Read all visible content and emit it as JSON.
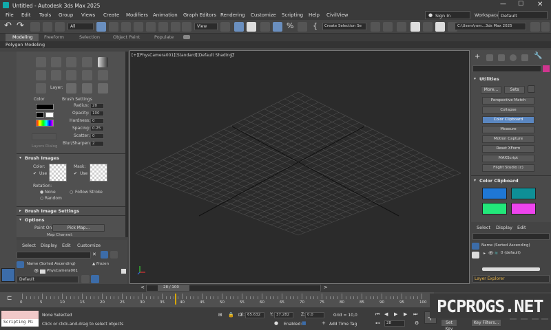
{
  "title": "Untitled - Autodesk 3ds Max 2025",
  "menu": [
    "File",
    "Edit",
    "Tools",
    "Group",
    "Views",
    "Create",
    "Modifiers",
    "Animation",
    "Graph Editors",
    "Rendering",
    "Customize",
    "Scripting",
    "Help",
    "CivilView"
  ],
  "signin": "Sign In",
  "workspaces_label": "Workspaces:",
  "workspace": "Default",
  "toolbar": {
    "filter": "All",
    "view": "View",
    "selection_set": "Create Selection Se",
    "path": "C:\\Users\\rom...3ds Max 2025"
  },
  "ribbon_tabs": [
    "Modeling",
    "Freeform",
    "Selection",
    "Object Paint",
    "Populate"
  ],
  "ribbon_sub": "Polygon Modeling",
  "left": {
    "layer_label": "Layer:",
    "color_label": "Color",
    "brush_settings": "Brush Settings",
    "settings": [
      {
        "label": "Radius:",
        "value": "20"
      },
      {
        "label": "Opacity:",
        "value": "100"
      },
      {
        "label": "Hardness:",
        "value": "0"
      },
      {
        "label": "Spacing:",
        "value": "0.25"
      },
      {
        "label": "Scatter:",
        "value": "0"
      },
      {
        "label": "Blur/Sharpen:",
        "value": "2"
      }
    ],
    "layers_dialog": "Layers Dialog",
    "brush_images": "Brush Images",
    "color_sub": "Color:",
    "mask_sub": "Mask:",
    "use": "Use",
    "rotation": "Rotation:",
    "none": "None",
    "follow_stroke": "Follow Stroke",
    "random": "Random",
    "brush_image_settings": "Brush Image Settings",
    "options": "Options",
    "paint_on": "Paint On:",
    "pick_map": "Pick Map...",
    "map_channel": "Map Channel:"
  },
  "scene": {
    "tabs": [
      "Select",
      "Display",
      "Edit",
      "Customize"
    ],
    "col_name": "Name (Sorted Ascending)",
    "col_frozen": "▲ Frozen",
    "row": "PhysCamera001",
    "layer": "Default"
  },
  "viewport_label": "[+][PhysCamera001][Standard][Default Shading]",
  "right": {
    "utilities": "Utilities",
    "more": "More...",
    "sets": "Sets",
    "buttons": [
      "Perspective Match",
      "Collapse",
      "Color Clipboard",
      "Measure",
      "Motion Capture",
      "Reset XForm",
      "MAXScript",
      "Flight Studio (c)"
    ],
    "active_button": "Color Clipboard",
    "clipboard": "Color Clipboard",
    "swatches": [
      "#1f77d4",
      "#0e8f96",
      "#22e87a",
      "#ee44ee"
    ]
  },
  "layer_panel": {
    "tabs": [
      "Select",
      "Display",
      "Edit"
    ],
    "col": "Name (Sorted Ascending)",
    "row": "0 (default)",
    "explorer": "Layer Explorer"
  },
  "time": {
    "frame_display": "28 / 100",
    "ticks": [
      "0",
      "5",
      "10",
      "15",
      "20",
      "25",
      "30",
      "35",
      "40",
      "45",
      "50",
      "55",
      "60",
      "65",
      "70",
      "75",
      "80",
      "85",
      "90",
      "95",
      "100"
    ]
  },
  "status": {
    "mini": "Scripting Mi",
    "none_selected": "None Selected",
    "prompt": "Click or click-and-drag to select objects",
    "x_label": "X:",
    "x": "65.632",
    "y_label": "Y:",
    "y": "37.282",
    "z_label": "Z:",
    "z": "0.0",
    "grid": "Grid = 10,0",
    "enabled": "Enabled:",
    "add_time_tag": "Add Time Tag",
    "set_key": "Set Key",
    "key_filters": "Key Filters...",
    "frame": "28"
  },
  "watermark": "PCPROGS.NET"
}
